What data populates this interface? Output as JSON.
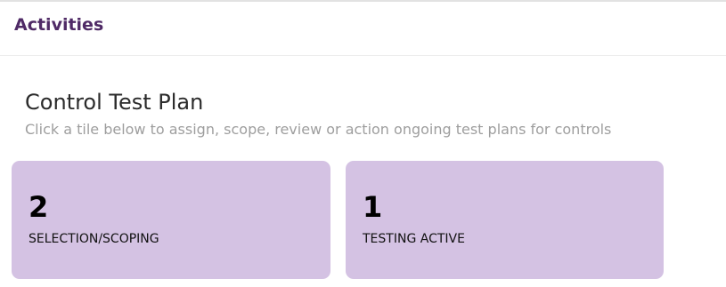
{
  "header": {
    "title": "Activities"
  },
  "section": {
    "title": "Control Test Plan",
    "subtitle": "Click a tile below to assign, scope, review or action ongoing test plans for controls"
  },
  "tiles": [
    {
      "count": "2",
      "label": "SELECTION/SCOPING"
    },
    {
      "count": "1",
      "label": "TESTING ACTIVE"
    }
  ],
  "colors": {
    "header_title": "#4f2a66",
    "tile_background": "#d4c2e3"
  }
}
